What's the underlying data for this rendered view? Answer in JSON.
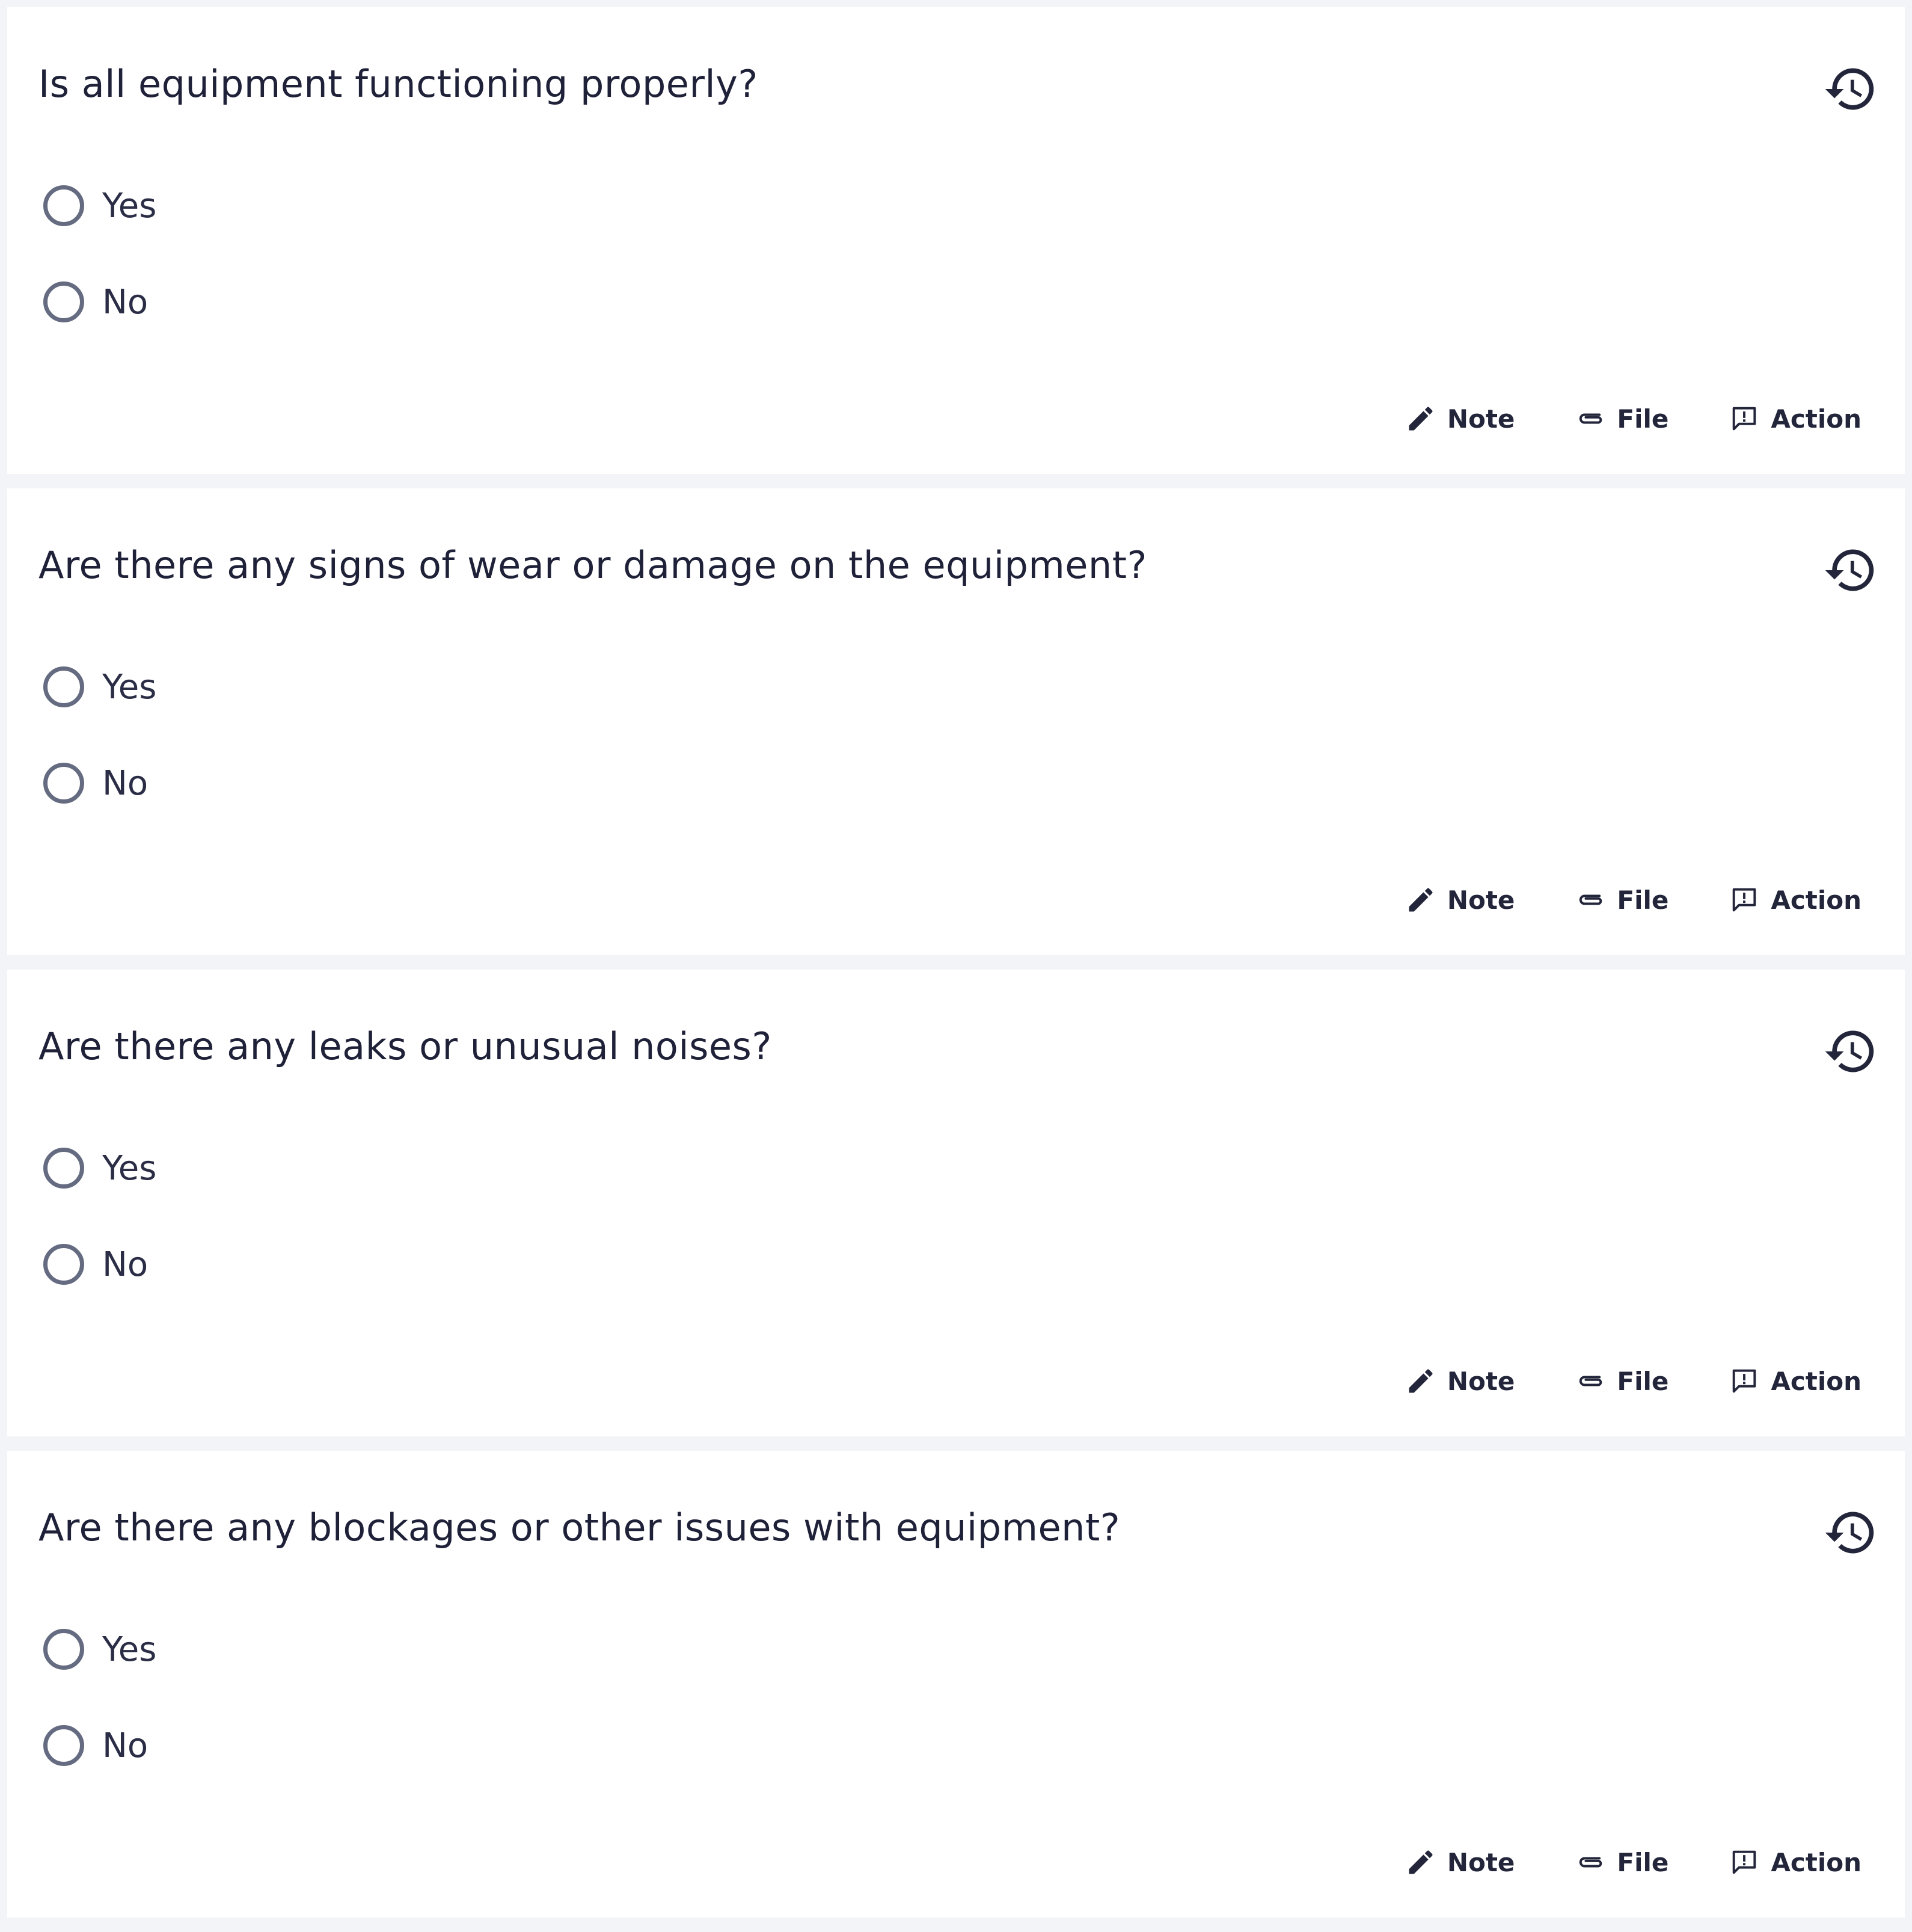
{
  "questions": [
    {
      "text": "Is all equipment functioning properly?",
      "options": [
        "Yes",
        "No"
      ],
      "actions": {
        "note": "Note",
        "file": "File",
        "action": "Action"
      }
    },
    {
      "text": "Are there any signs of wear or damage on the equipment?",
      "options": [
        "Yes",
        "No"
      ],
      "actions": {
        "note": "Note",
        "file": "File",
        "action": "Action"
      }
    },
    {
      "text": "Are there any leaks or unusual noises?",
      "options": [
        "Yes",
        "No"
      ],
      "actions": {
        "note": "Note",
        "file": "File",
        "action": "Action"
      }
    },
    {
      "text": "Are there any blockages or other issues with equipment?",
      "options": [
        "Yes",
        "No"
      ],
      "actions": {
        "note": "Note",
        "file": "File",
        "action": "Action"
      }
    }
  ],
  "icons": {
    "history": "history-icon",
    "note": "pencil-icon",
    "file": "paperclip-icon",
    "action": "comment-alert-icon"
  },
  "colors": {
    "background": "#f3f4f7",
    "card": "#ffffff",
    "text": "#1f2139",
    "radio_border": "#656b80"
  }
}
